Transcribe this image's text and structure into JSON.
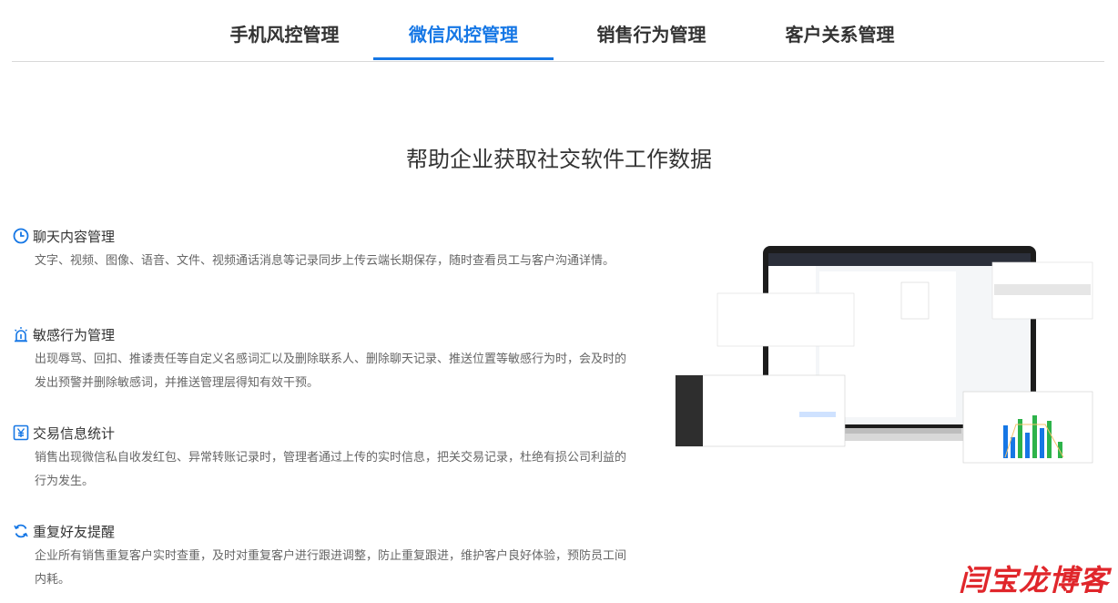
{
  "tabs": [
    {
      "label": "手机风控管理",
      "active": false
    },
    {
      "label": "微信风控管理",
      "active": true
    },
    {
      "label": "销售行为管理",
      "active": false
    },
    {
      "label": "客户关系管理",
      "active": false
    }
  ],
  "headline": "帮助企业获取社交软件工作数据",
  "features": [
    {
      "icon": "clock-icon",
      "title": "聊天内容管理",
      "desc": "文字、视频、图像、语音、文件、视频通话消息等记录同步上传云端长期保存，随时查看员工与客户沟通详情。"
    },
    {
      "icon": "alarm-icon",
      "title": "敏感行为管理",
      "desc": "出现辱骂、回扣、推诿责任等自定义名感词汇以及删除联系人、删除聊天记录、推送位置等敏感行为时，会及时的发出预警并删除敏感词，并推送管理层得知有效干预。"
    },
    {
      "icon": "yen-icon",
      "title": "交易信息统计",
      "desc": "销售出现微信私自收发红包、异常转账记录时，管理者通过上传的实时信息，把关交易记录，杜绝有损公司利益的行为发生。"
    },
    {
      "icon": "refresh-icon",
      "title": "重复好友提醒",
      "desc": "企业所有销售重复客户实时查重，及时对重复客户进行跟进调整，防止重复跟进，维护客户良好体验，预防员工间内耗。"
    }
  ],
  "brand": "闫宝龙博客",
  "colors": {
    "accent": "#1677e5",
    "brand": "#e0262b"
  }
}
